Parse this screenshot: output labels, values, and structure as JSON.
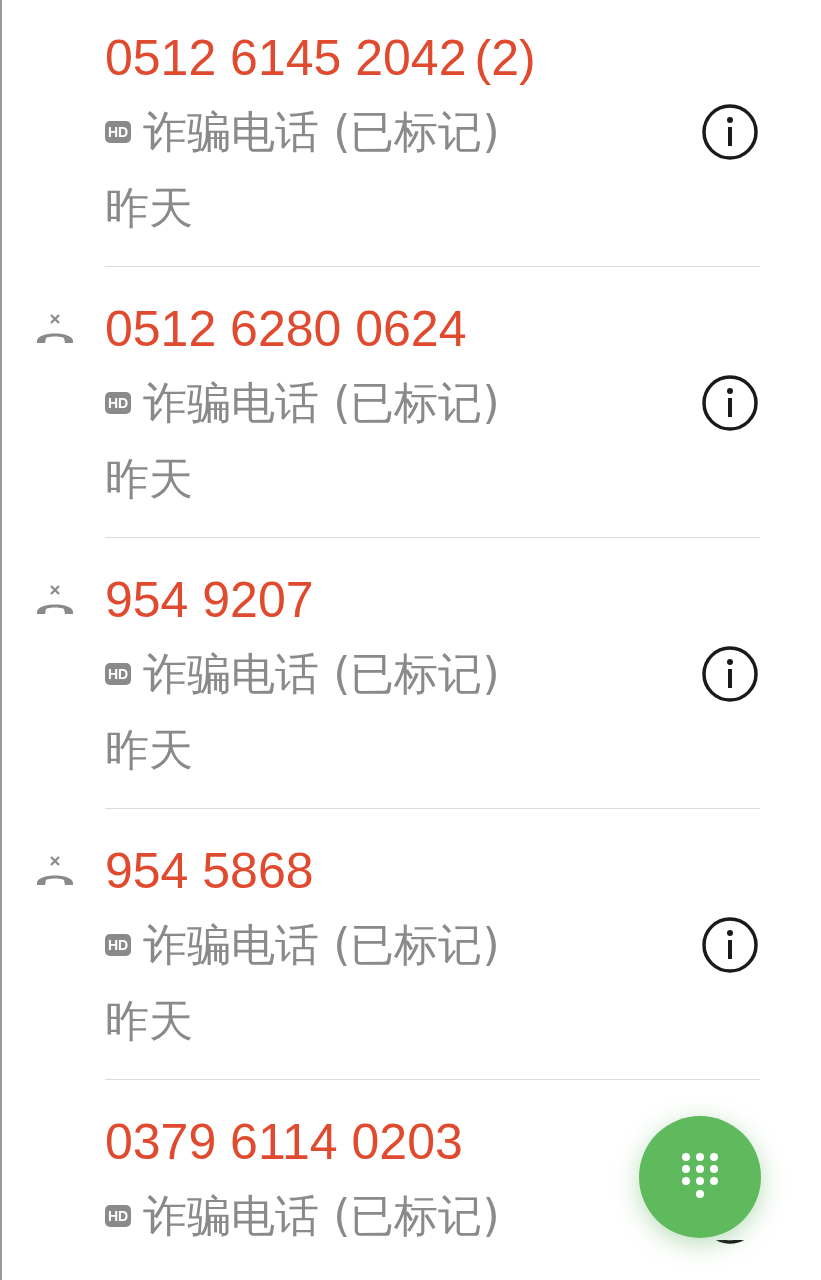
{
  "calls": [
    {
      "number": "0512 6145 2042",
      "count": "(2)",
      "missed": false,
      "hd": "HD",
      "label": "诈骗电话 (已标记)",
      "date": "昨天"
    },
    {
      "number": "0512 6280 0624",
      "missed": true,
      "hd": "HD",
      "label": "诈骗电话 (已标记)",
      "date": "昨天"
    },
    {
      "number": "954 9207",
      "missed": true,
      "hd": "HD",
      "label": "诈骗电话 (已标记)",
      "date": "昨天"
    },
    {
      "number": "954 5868",
      "missed": true,
      "hd": "HD",
      "label": "诈骗电话 (已标记)",
      "date": "昨天"
    },
    {
      "number": "0379 6114 0203",
      "missed": false,
      "hd": "HD",
      "label": "诈骗电话 (已标记)"
    }
  ]
}
